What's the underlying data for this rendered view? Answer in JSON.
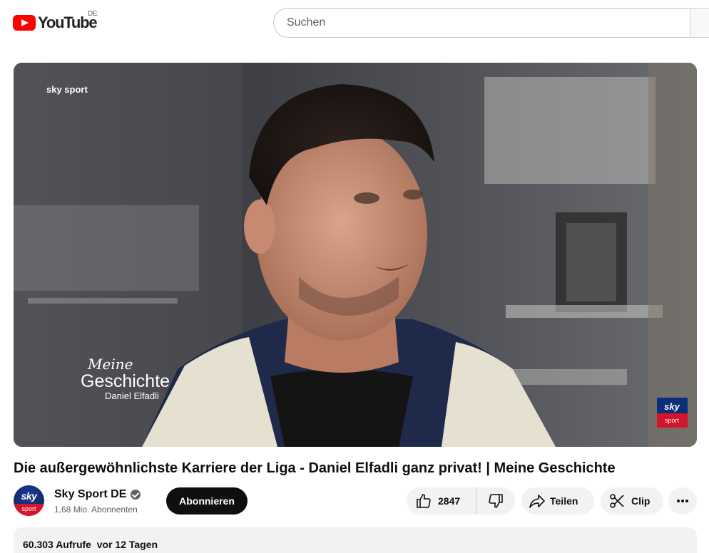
{
  "header": {
    "logo_text": "YouTube",
    "region": "DE",
    "search_placeholder": "Suchen"
  },
  "video": {
    "overlay_brand": "sky sport",
    "overlay_title_line1": "Meine",
    "overlay_title_line2": "Geschichte",
    "overlay_name": "Daniel Elfadli",
    "corner_logo_top": "sky",
    "corner_logo_bottom": "sport"
  },
  "title": "Die außergewöhnlichste Karriere der Liga - Daniel Elfadli ganz privat! | Meine Geschichte",
  "channel": {
    "avatar_top": "sky",
    "avatar_bottom": "sport",
    "name": "Sky Sport DE",
    "subscribers": "1,68 Mio. Abonnenten",
    "subscribe_label": "Abonnieren"
  },
  "actions": {
    "like_count": "2847",
    "share_label": "Teilen",
    "clip_label": "Clip"
  },
  "description": {
    "views": "60.303 Aufrufe",
    "date": "vor 12 Tagen"
  },
  "colors": {
    "youtube_red": "#ff0000",
    "sky_red": "#d4142a",
    "sky_blue": "#0b1e5a"
  }
}
